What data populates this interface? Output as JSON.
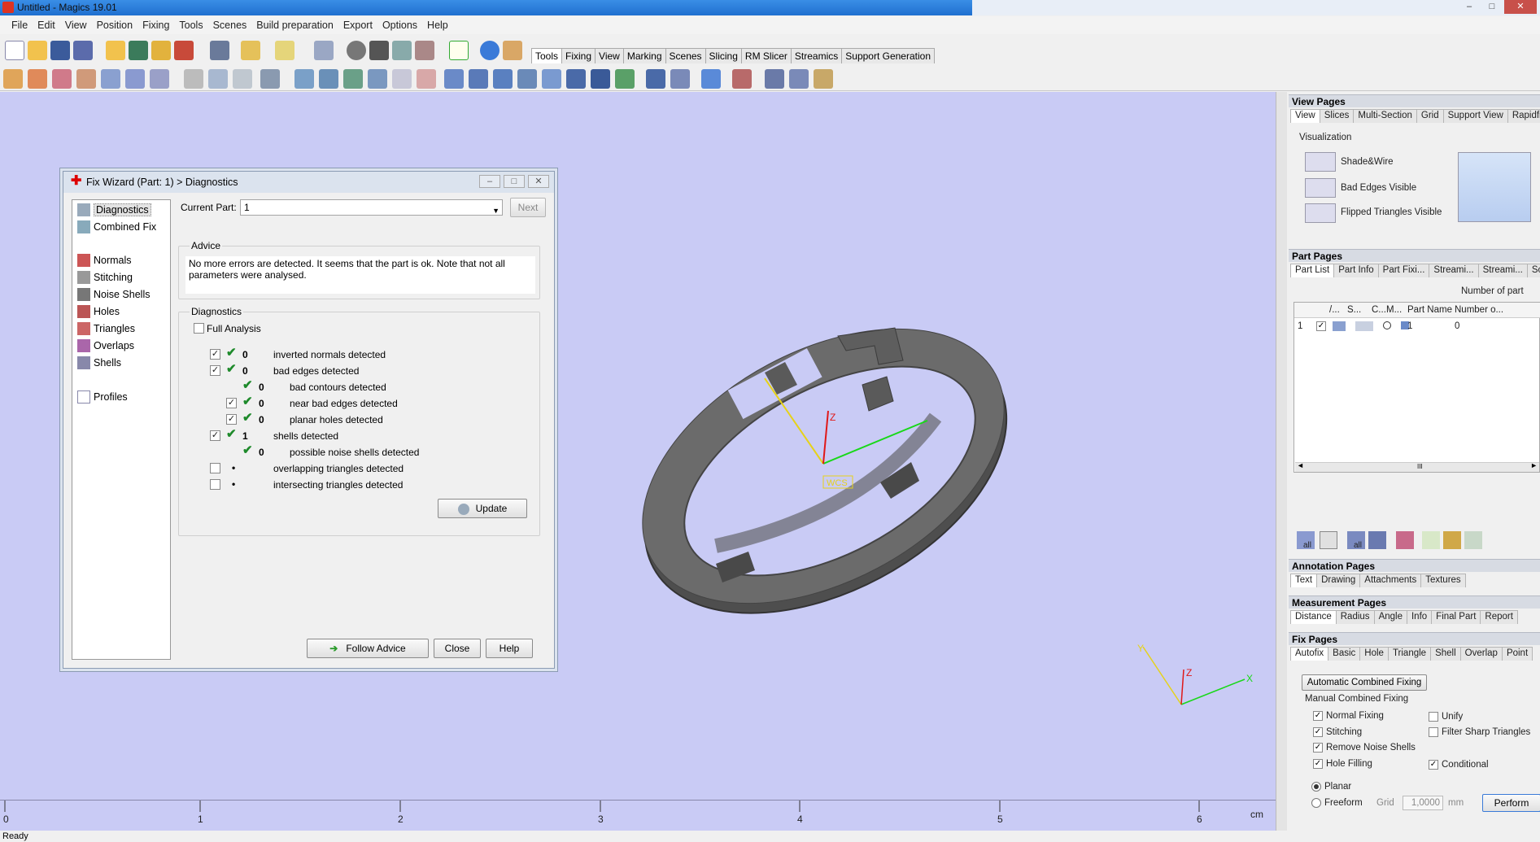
{
  "window": {
    "title": "Untitled - Magics 19.01",
    "minimize": "–",
    "maximize": "□",
    "close": "✕"
  },
  "menu": [
    "File",
    "Edit",
    "View",
    "Position",
    "Fixing",
    "Tools",
    "Scenes",
    "Build preparation",
    "Export",
    "Options",
    "Help"
  ],
  "toolbar_tabs": [
    "Tools",
    "Fixing",
    "View",
    "Marking",
    "Scenes",
    "Slicing",
    "RM Slicer",
    "Streamics",
    "Support Generation"
  ],
  "toolbar_active_tab": "Tools",
  "dialog": {
    "title": "Fix Wizard (Part: 1) > Diagnostics",
    "nav": [
      "Diagnostics",
      "Combined Fix",
      "Normals",
      "Stitching",
      "Noise Shells",
      "Holes",
      "Triangles",
      "Overlaps",
      "Shells",
      "Profiles"
    ],
    "current_part_label": "Current Part:",
    "current_part_value": "1",
    "next_label": "Next",
    "advice_label": "Advice",
    "advice_text": "No more errors are detected. It seems that the part is ok. Note that not all parameters were analysed.",
    "diagnostics_label": "Diagnostics",
    "full_analysis": "Full Analysis",
    "rows": [
      {
        "text": "inverted normals detected",
        "count": "0"
      },
      {
        "text": "bad edges detected",
        "count": "0"
      },
      {
        "text": "bad contours detected",
        "count": "0"
      },
      {
        "text": "near bad edges detected",
        "count": "0"
      },
      {
        "text": "planar holes detected",
        "count": "0"
      },
      {
        "text": "shells detected",
        "count": "1"
      },
      {
        "text": "possible noise shells detected",
        "count": "0"
      },
      {
        "text": "overlapping triangles detected",
        "count": "•"
      },
      {
        "text": "intersecting triangles detected",
        "count": "•"
      }
    ],
    "update_label": "Update",
    "follow_advice_label": "Follow Advice",
    "close_label": "Close",
    "help_label": "Help"
  },
  "viewport": {
    "wcs_label": "WCS",
    "axis_z": "Z",
    "ruler_labels": [
      "0",
      "1",
      "2",
      "3",
      "4",
      "5",
      "6"
    ],
    "ruler_unit": "cm"
  },
  "right_panel": {
    "view_pages": {
      "title": "View Pages",
      "tabs": [
        "View",
        "Slices",
        "Multi-Section",
        "Grid",
        "Support View",
        "Rapidfit V"
      ],
      "visualization_label": "Visualization",
      "items": [
        "Shade&Wire",
        "Bad Edges Visible",
        "Flipped Triangles Visible"
      ]
    },
    "part_pages": {
      "title": "Part Pages",
      "tabs": [
        "Part List",
        "Part Info",
        "Part Fixi...",
        "Streami...",
        "Streami...",
        "Scen"
      ],
      "number_of_parts": "Number of part",
      "columns": [
        "/...",
        "S...",
        "C...",
        "M...",
        "Part Name",
        "Number o..."
      ],
      "row": {
        "index": "1",
        "name": "1",
        "number": "0"
      },
      "scroll_marker": "III",
      "icon_labels": [
        "all",
        "all"
      ]
    },
    "annotation_pages": {
      "title": "Annotation Pages",
      "tabs": [
        "Text",
        "Drawing",
        "Attachments",
        "Textures"
      ]
    },
    "measurement_pages": {
      "title": "Measurement Pages",
      "tabs": [
        "Distance",
        "Radius",
        "Angle",
        "Info",
        "Final Part",
        "Report"
      ]
    },
    "fix_pages": {
      "title": "Fix Pages",
      "tabs": [
        "Autofix",
        "Basic",
        "Hole",
        "Triangle",
        "Shell",
        "Overlap",
        "Point"
      ],
      "auto_btn": "Automatic Combined Fixing",
      "manual_label": "Manual Combined Fixing",
      "left_checks": [
        "Normal Fixing",
        "Stitching",
        "Remove Noise Shells",
        "Hole Filling"
      ],
      "right_checks": [
        "Unify",
        "Filter Sharp Triangles",
        "Conditional"
      ],
      "planar": "Planar",
      "freeform": "Freeform",
      "grid_label": "Grid",
      "grid_value": "1,0000",
      "grid_unit": "mm",
      "perform": "Perform"
    }
  },
  "status": "Ready",
  "colors": {
    "viewport": "#c9cbf5",
    "model": "#555555",
    "accent": "#1f6fcf"
  }
}
